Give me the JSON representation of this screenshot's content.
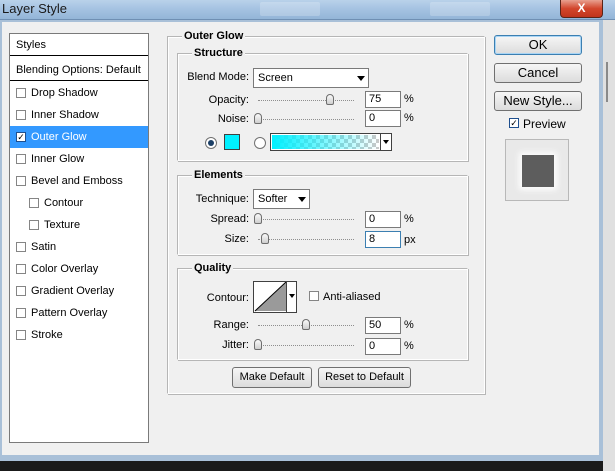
{
  "window": {
    "title": "Layer Style",
    "close_glyph": "X"
  },
  "styles_list": {
    "header": "Styles",
    "blending": "Blending Options: Default",
    "items": [
      {
        "label": "Drop Shadow",
        "checked": false
      },
      {
        "label": "Inner Shadow",
        "checked": false
      },
      {
        "label": "Outer Glow",
        "checked": true,
        "selected": true
      },
      {
        "label": "Inner Glow",
        "checked": false
      },
      {
        "label": "Bevel and Emboss",
        "checked": false
      },
      {
        "label": "Contour",
        "checked": false,
        "sub": true
      },
      {
        "label": "Texture",
        "checked": false,
        "sub": true
      },
      {
        "label": "Satin",
        "checked": false
      },
      {
        "label": "Color Overlay",
        "checked": false
      },
      {
        "label": "Gradient Overlay",
        "checked": false
      },
      {
        "label": "Pattern Overlay",
        "checked": false
      },
      {
        "label": "Stroke",
        "checked": false
      }
    ]
  },
  "outer_glow": {
    "title": "Outer Glow",
    "structure": {
      "title": "Structure",
      "blend_mode_label": "Blend Mode:",
      "blend_mode": "Screen",
      "opacity_label": "Opacity:",
      "opacity": "75",
      "opacity_unit": "%",
      "opacity_level": 75,
      "noise_label": "Noise:",
      "noise": "0",
      "noise_unit": "%",
      "noise_level": 0,
      "color_selected": "solid",
      "glow_color": "#00f0ff"
    },
    "elements": {
      "title": "Elements",
      "technique_label": "Technique:",
      "technique": "Softer",
      "spread_label": "Spread:",
      "spread": "0",
      "spread_unit": "%",
      "spread_level": 0,
      "size_label": "Size:",
      "size": "8",
      "size_unit": "px",
      "size_level": 3
    },
    "quality": {
      "title": "Quality",
      "contour_label": "Contour:",
      "anti_aliased_label": "Anti-aliased",
      "anti_aliased": false,
      "range_label": "Range:",
      "range": "50",
      "range_unit": "%",
      "range_level": 50,
      "jitter_label": "Jitter:",
      "jitter": "0",
      "jitter_unit": "%",
      "jitter_level": 0
    },
    "make_default": "Make Default",
    "reset_default": "Reset to Default"
  },
  "actions": {
    "ok": "OK",
    "cancel": "Cancel",
    "new_style": "New Style...",
    "preview_label": "Preview",
    "preview_checked": true
  }
}
